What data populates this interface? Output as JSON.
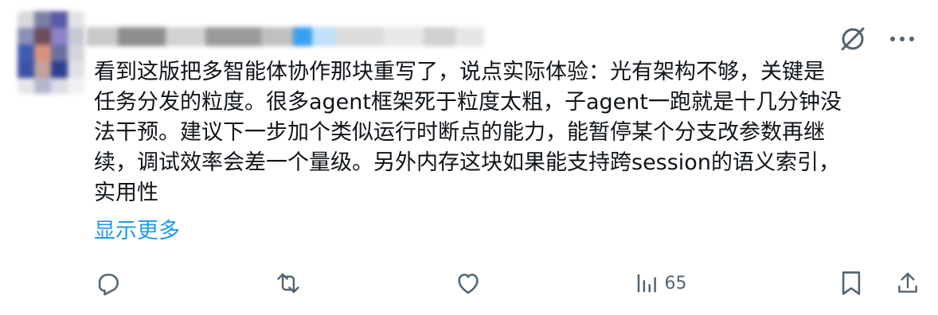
{
  "colors": {
    "accent": "#1d9bf0",
    "text": "#0f1419",
    "muted": "#536471"
  },
  "tweet": {
    "author_obscured": true,
    "text": "看到这版把多智能体协作那块重写了，说点实际体验：光有架构不够，关键是\n任务分发的粒度。很多agent框架死于粒度太粗，子agent一跑就是十几分钟没\n法干预。建议下一步加个类似运行时断点的能力，能暂停某个分支改参数再继\n续，调试效率会差一个量级。另外内存这块如果能支持跨session的语义索引，\n实用性",
    "show_more": "显示更多"
  },
  "header_actions": {
    "grok_icon": "grok-icon",
    "more_icon": "more-icon"
  },
  "actions": {
    "reply": {
      "icon": "reply-icon"
    },
    "retweet": {
      "icon": "retweet-icon"
    },
    "like": {
      "icon": "like-icon"
    },
    "views": {
      "icon": "views-icon",
      "count": "65"
    },
    "bookmark": {
      "icon": "bookmark-icon"
    },
    "share": {
      "icon": "share-icon"
    }
  }
}
